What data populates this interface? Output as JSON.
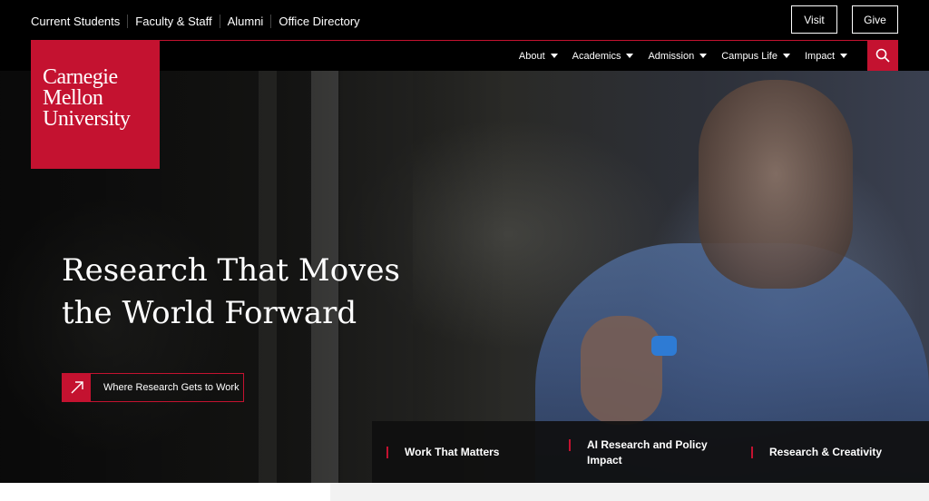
{
  "utility": {
    "links": [
      "Current Students",
      "Faculty & Staff",
      "Alumni",
      "Office Directory"
    ],
    "visit_label": "Visit",
    "give_label": "Give"
  },
  "logo": {
    "line1": "Carnegie",
    "line2": "Mellon",
    "line3": "University"
  },
  "nav": {
    "items": [
      {
        "label": "About"
      },
      {
        "label": "Academics"
      },
      {
        "label": "Admission"
      },
      {
        "label": "Campus Life"
      },
      {
        "label": "Impact"
      }
    ],
    "search_icon": "search-icon"
  },
  "hero": {
    "headline": "Research That Moves the World Forward",
    "cta_label": "Where Research Gets to Work",
    "cta_icon": "arrow-up-right-icon"
  },
  "tabs": [
    {
      "label": "Work That Matters"
    },
    {
      "label": "AI Research and Policy Impact"
    },
    {
      "label": "Research & Creativity"
    }
  ],
  "colors": {
    "brand_red": "#c41230",
    "background": "#000000"
  }
}
